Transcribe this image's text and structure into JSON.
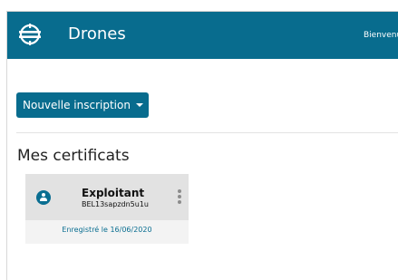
{
  "header": {
    "app_title": "Drones",
    "welcome_text": "Bienvenu",
    "logo_icon": "drone-logo-icon",
    "background_color": "#086c8e"
  },
  "actions": {
    "new_registration_label": "Nouvelle inscription",
    "dropdown_icon": "caret-down-icon"
  },
  "section": {
    "title": "Mes certificats"
  },
  "certificates": [
    {
      "type": "Exploitant",
      "id": "BEL13sapzdn5u1u",
      "registered": "Enregistré le 16/06/2020",
      "icon": "user-icon",
      "menu_icon": "kebab-menu-icon"
    }
  ],
  "colors": {
    "accent": "#086c8e",
    "card_header": "#e2e2e2",
    "card_body": "#f3f3f3"
  }
}
